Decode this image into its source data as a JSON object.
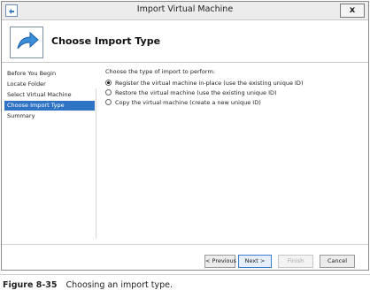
{
  "window": {
    "title": "Import Virtual Machine",
    "close_glyph": "x",
    "icons": [
      "app-window-icon",
      "import-arrow-icon"
    ]
  },
  "header": {
    "title": "Choose Import Type"
  },
  "sidebar": {
    "items": [
      {
        "label": "Before You Begin",
        "active": false
      },
      {
        "label": "Locate Folder",
        "active": false
      },
      {
        "label": "Select Virtual Machine",
        "active": false
      },
      {
        "label": "Choose Import Type",
        "active": true
      },
      {
        "label": "Summary",
        "active": false
      }
    ]
  },
  "main": {
    "prompt": "Choose the type of import to perform:",
    "options": [
      {
        "label": "Register the virtual machine in-place (use the existing unique ID)",
        "checked": true
      },
      {
        "label": "Restore the virtual machine (use the existing unique ID)",
        "checked": false
      },
      {
        "label": "Copy the virtual machine (create a new unique ID)",
        "checked": false
      }
    ]
  },
  "buttons": {
    "previous": "< Previous",
    "next": "Next >",
    "finish": "Finish",
    "cancel": "Cancel"
  },
  "caption": {
    "number": "Figure 8-35",
    "text": "Choosing an import type."
  },
  "colors": {
    "accent": "#2f73c4",
    "titlebar": "#ececec"
  }
}
